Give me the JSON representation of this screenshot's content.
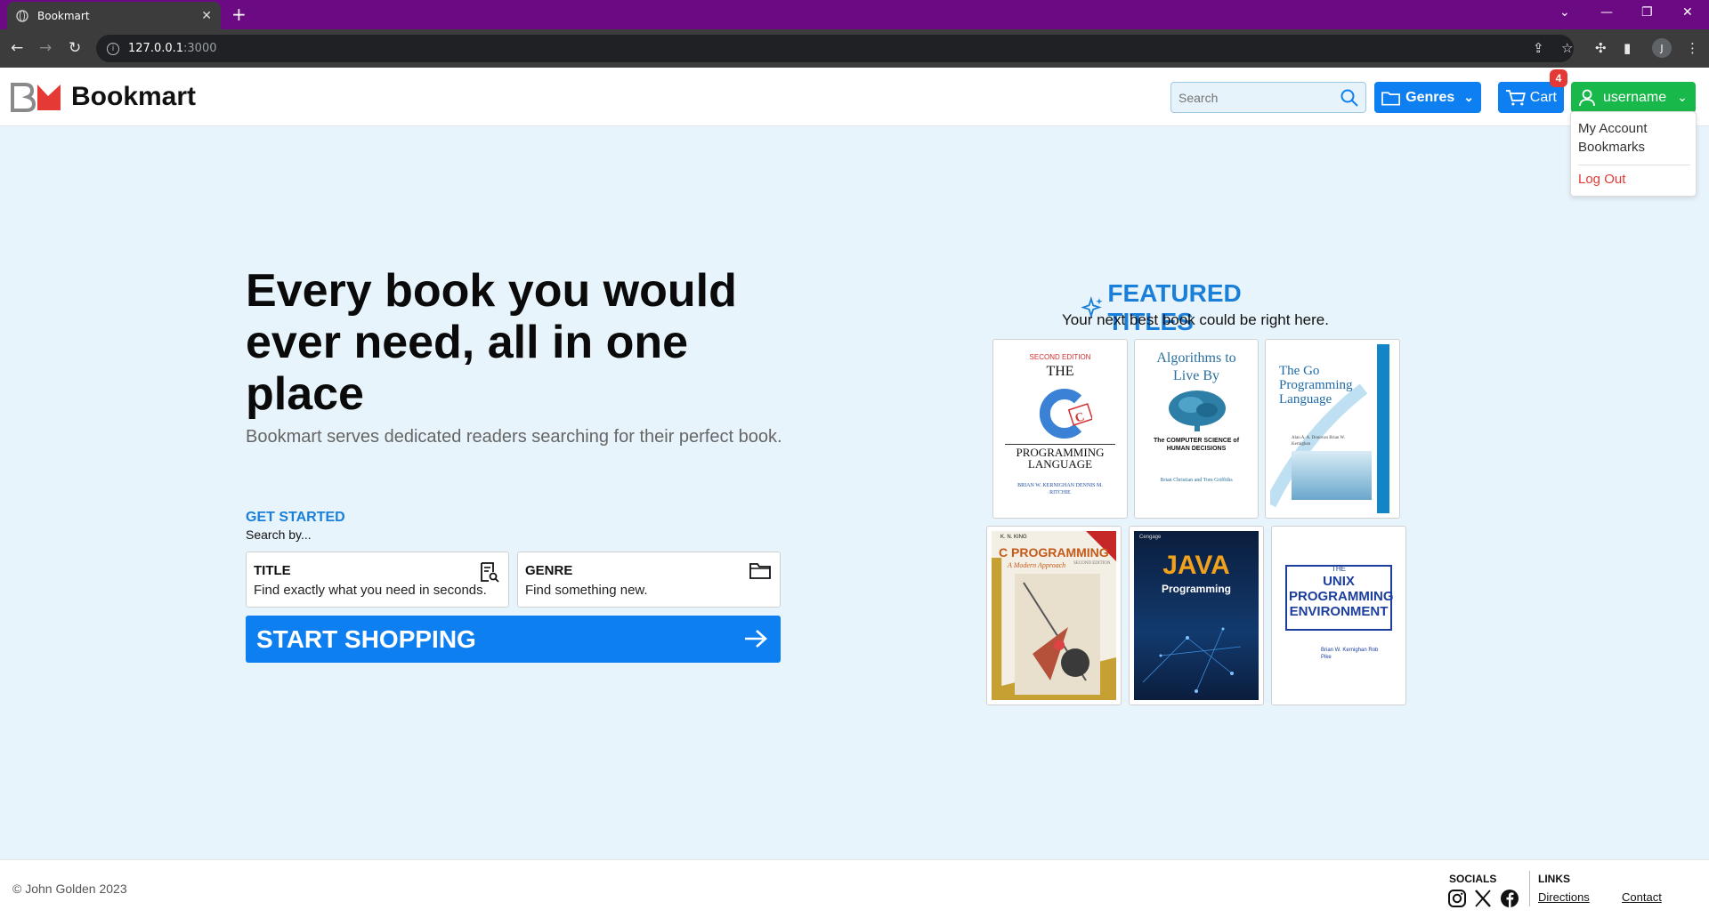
{
  "browser": {
    "tab_title": "Bookmart",
    "url_host": "127.0.0.1",
    "url_port": ":3000",
    "profile_initial": "J"
  },
  "header": {
    "brand": "Bookmart",
    "search_placeholder": "Search",
    "genres_label": "Genres",
    "cart_label": "Cart",
    "cart_count": "4",
    "user_label": "username"
  },
  "user_menu": {
    "items": [
      "My Account",
      "Bookmarks"
    ],
    "logout": "Log Out"
  },
  "hero": {
    "title": "Every book you would ever need, all in one place",
    "subtitle": "Bookmart serves dedicated readers searching for their perfect book.",
    "get_started": "GET STARTED",
    "search_by": "Search by...",
    "cards": [
      {
        "title": "TITLE",
        "desc": "Find exactly what you need in seconds."
      },
      {
        "title": "GENRE",
        "desc": "Find something new."
      }
    ],
    "cta": "START SHOPPING"
  },
  "featured": {
    "title": "FEATURED TITLES",
    "subtitle": "Your next best book could be right here.",
    "books": [
      {
        "l1": "SECOND EDITION",
        "l2": "THE",
        "l3": "PROGRAMMING LANGUAGE",
        "l4": "BRIAN W. KERNIGHAN DENNIS M. RITCHIE"
      },
      {
        "l1": "Algorithms to Live By",
        "l2": "The COMPUTER SCIENCE of HUMAN DECISIONS",
        "l3": "Brian Christian and Tom Griffiths"
      },
      {
        "l1": "The Go Programming Language",
        "l2": "Alan A. A. Donovan Brian W. Kernighan"
      },
      {
        "l1": "K. N. KING",
        "l2": "C PROGRAMMING",
        "l3": "A Modern Approach",
        "l4": "SECOND EDITION"
      },
      {
        "l1": "Cengage",
        "l2": "JAVA",
        "l3": "Programming"
      },
      {
        "l1": "THE",
        "l2": "UNIX PROGRAMMING ENVIRONMENT",
        "l3": "Brian W. Kernighan Rob Pike"
      }
    ]
  },
  "footer": {
    "copyright": "© John Golden 2023",
    "socials_heading": "SOCIALS",
    "links_heading": "LINKS",
    "links": [
      "Directions",
      "Contact"
    ]
  }
}
